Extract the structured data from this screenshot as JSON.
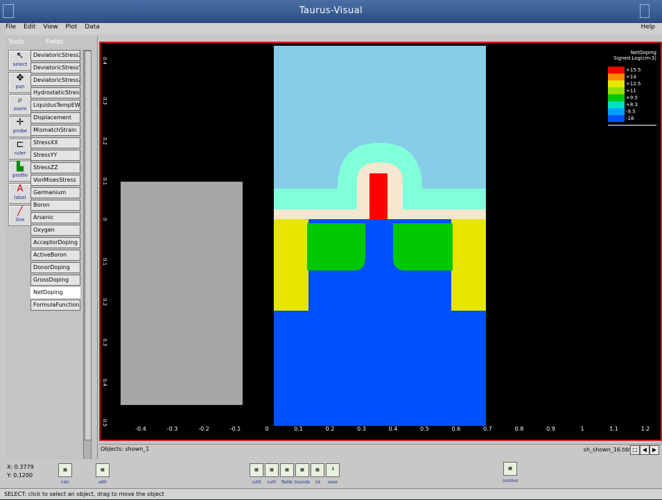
{
  "window": {
    "title": "Taurus-Visual"
  },
  "menu": {
    "items": [
      "File",
      "Edit",
      "View",
      "Plot",
      "Data"
    ],
    "help": "Help"
  },
  "panel": {
    "tools_header": "Tools",
    "fields_header": "Fields"
  },
  "tools": [
    {
      "label": "select",
      "icon": "arrow-icon"
    },
    {
      "label": "pan",
      "icon": "move-icon"
    },
    {
      "label": "zoom",
      "icon": "zoom-icon"
    },
    {
      "label": "probe",
      "icon": "probe-icon"
    },
    {
      "label": "ruler",
      "icon": "ruler-icon"
    },
    {
      "label": "profile",
      "icon": "profile-icon"
    },
    {
      "label": "label",
      "icon": "text-icon"
    },
    {
      "label": "line",
      "icon": "line-icon"
    }
  ],
  "fields": [
    "DeviatoricStressX",
    "DeviatoricStressY",
    "DeviatoricStressZ",
    "HydrostaticStress",
    "LiquidusTempEW",
    "Displacement",
    "MismatchStrain",
    "StressXX",
    "StressYY",
    "StressZZ",
    "VonMisesStress",
    "Germanium",
    "Boron",
    "Arsenic",
    "Oxygen",
    "AcceptorDoping",
    "ActiveBoron",
    "DonorDoping",
    "GrossDoping",
    "NetDoping",
    "FormulaFunction"
  ],
  "selected_field": "NetDoping",
  "legend": {
    "title1": "NetDoping",
    "title2": "Signed Log(cm-3)",
    "entries": [
      {
        "label": "+15.5",
        "color": "#ff0000"
      },
      {
        "label": "+14",
        "color": "#ff8a00"
      },
      {
        "label": "+12.5",
        "color": "#e6e600"
      },
      {
        "label": "+11",
        "color": "#90e000"
      },
      {
        "label": "+9.5",
        "color": "#00c800"
      },
      {
        "label": "+8.3",
        "color": "#00e0c0"
      },
      {
        "label": "-9.5",
        "color": "#00a0ff"
      },
      {
        "label": "-18",
        "color": "#0050ff"
      }
    ]
  },
  "xaxis": {
    "ticks": [
      "-0.4",
      "-0.3",
      "-0.2",
      "-0.1",
      "0",
      "0.1",
      "0.2",
      "0.3",
      "0.4",
      "0.5",
      "0.6",
      "0.7",
      "0.8",
      "0.9",
      "1",
      "1.1",
      "1.2"
    ]
  },
  "yaxis": {
    "ticks": [
      "0.4",
      "0.3",
      "0.2",
      "0.1",
      "0",
      "0.1",
      "0.2",
      "0.3",
      "0.4",
      "0.5"
    ]
  },
  "object_bar": {
    "objects": "Objects: shown_1",
    "file": "sh_shown_16.tdr"
  },
  "coords": {
    "x": "X: 0.3779",
    "y": "Y: 0.1200"
  },
  "bottom_icons": {
    "left": [
      {
        "label": "calc"
      },
      {
        "label": "edit"
      }
    ],
    "middle": [
      {
        "label": "cutX"
      },
      {
        "label": "cutY"
      },
      {
        "label": "fields"
      },
      {
        "label": "bounds"
      },
      {
        "label": "1d"
      },
      {
        "label": "axes"
      }
    ],
    "right": [
      {
        "label": "contour"
      }
    ]
  },
  "status": "SELECT: click to select an object, drag to move the object"
}
